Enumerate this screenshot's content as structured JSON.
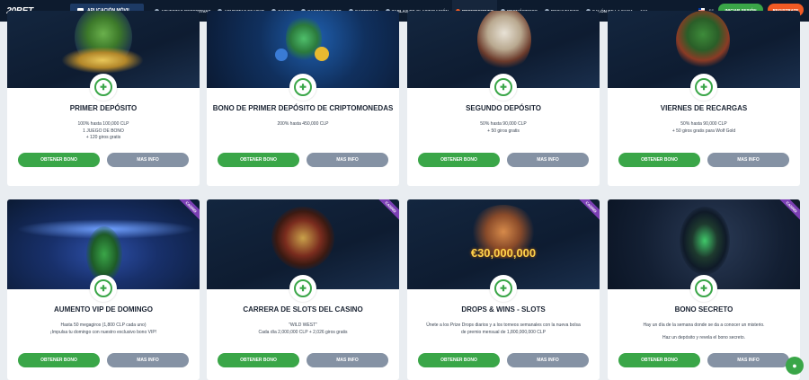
{
  "header": {
    "logo_text": "20BET",
    "app_button_label": "APLICACIÓN MÓVIL",
    "nav": [
      {
        "label": "APUESTAS DEPORTIVAS"
      },
      {
        "label": "APUESTAS EN VIVO"
      },
      {
        "label": "CASINO"
      },
      {
        "label": "CASINO EN VIVO"
      },
      {
        "label": "CARRERAS"
      },
      {
        "label": "TABLAS DE CLASIFICACIÓN"
      },
      {
        "label": "PROMOCIONES",
        "active": true
      },
      {
        "label": "PRONÓSTICOS"
      },
      {
        "label": "RESULTADOS"
      },
      {
        "label": "SALÓN DE LA FAMA"
      }
    ],
    "more_label": "•••",
    "lang_label": "ES",
    "login_label": "INICIAR SESIÓN",
    "register_label": "REGISTRATE"
  },
  "cards": [
    {
      "title": "PRIMER DEPÓSITO",
      "lines": [
        "100% hasta 100,000 CLP",
        "1 JUEGO DE BONO",
        "+ 120 giros gratis"
      ],
      "get_label": "OBTENER BONO",
      "info_label": "MAS INFO",
      "ribbon": ""
    },
    {
      "title": "BONO DE PRIMER DEPÓSITO DE CRIPTOMONEDAS",
      "lines": [
        "200% hasta 450,000 CLP"
      ],
      "get_label": "OBTENER BONO",
      "info_label": "MAS INFO",
      "ribbon": ""
    },
    {
      "title": "SEGUNDO DEPÓSITO",
      "lines": [
        "50% hasta 90,000 CLP",
        "+ 50 giros gratis"
      ],
      "get_label": "OBTENER BONO",
      "info_label": "MAS INFO",
      "ribbon": ""
    },
    {
      "title": "VIERNES DE RECARGAS",
      "lines": [
        "50% hasta 90,000 CLP",
        "+ 50 giros gratis para Wolf Gold"
      ],
      "get_label": "OBTENER BONO",
      "info_label": "MAS INFO",
      "ribbon": ""
    },
    {
      "title": "AUMENTO VIP DE DOMINGO",
      "lines": [
        "Hasta 50 megagiros (1,800 CLP cada uno)",
        "¡Impulsa tu domingo con nuestro exclusivo bono VIP!"
      ],
      "get_label": "OBTENER BONO",
      "info_label": "MAS INFO",
      "ribbon": "CASINO"
    },
    {
      "title": "CARRERA DE SLOTS DEL CASINO",
      "lines": [
        "\"WILD WEST\"",
        "Cada día 2,000,000 CLP + 2,026 giros gratis"
      ],
      "get_label": "OBTENER BONO",
      "info_label": "MAS INFO",
      "ribbon": "CASINO"
    },
    {
      "title": "DROPS & WINS - SLOTS",
      "lines": [
        "Únete a los Prize Drops diarios y a los torneos semanales con la nueva bolsa",
        "de premio mensual de 1,800,000,000 CLP"
      ],
      "get_label": "OBTENER BONO",
      "info_label": "MAS INFO",
      "ribbon": "CASINO",
      "banner_text": "€30,000,000"
    },
    {
      "title": "BONO SECRETO",
      "lines": [
        "Hay un día de la semana donde se da a conocer un misterio.",
        "Haz un depósito y revela el bono secreto."
      ],
      "get_label": "OBTENER BONO",
      "info_label": "MAS INFO",
      "ribbon": "CASINO"
    }
  ],
  "colors": {
    "nav_bg": "#0d1b2e",
    "accent_green": "#3aa648",
    "accent_orange": "#f05a24",
    "ribbon_purple": "#7b3fb4",
    "info_gray": "#8592a4"
  }
}
